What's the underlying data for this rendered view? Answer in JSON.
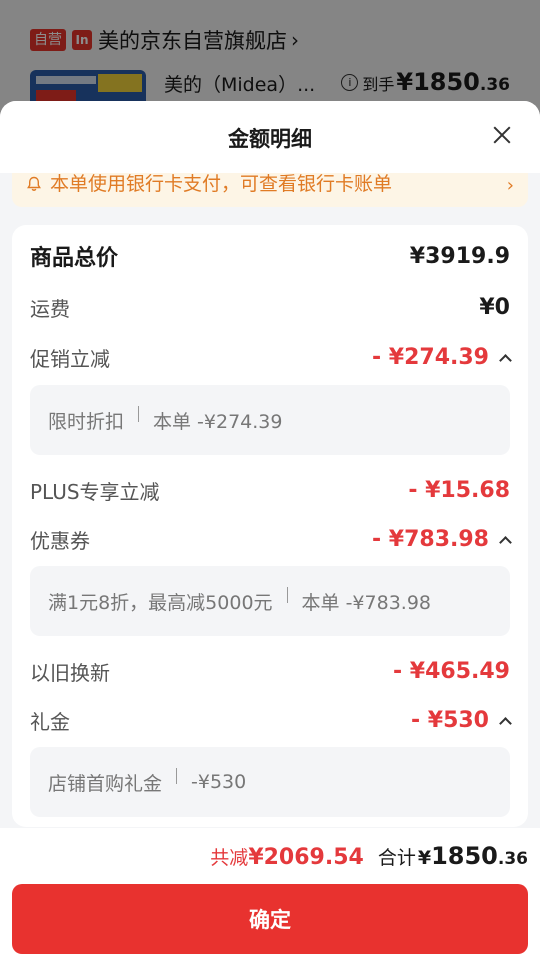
{
  "background": {
    "store": {
      "self_tag": "自营",
      "brand_tag": "In",
      "name": "美的京东自营旗舰店",
      "chevron": "›"
    },
    "product": {
      "title": "美的（Midea）...",
      "price_label": "到手",
      "price_main": "¥1850",
      "price_decimal": ".36"
    }
  },
  "sheet": {
    "title": "金额明细",
    "notice": {
      "text": "本单使用银行卡支付，可查看银行卡账单",
      "chevron": "›"
    },
    "rows": {
      "total": {
        "label": "商品总价",
        "value": "¥3919.9"
      },
      "shipping": {
        "label": "运费",
        "value": "¥0"
      },
      "promo": {
        "label": "促销立减",
        "value": "- ¥274.39"
      },
      "promo_detail": {
        "name": "限时折扣",
        "desc": "本单 -¥274.39"
      },
      "plus": {
        "label": "PLUS专享立减",
        "value": "- ¥15.68"
      },
      "coupon": {
        "label": "优惠券",
        "value": "- ¥783.98"
      },
      "coupon_detail": {
        "name": "满1元8折，最高减5000元",
        "desc": "本单 -¥783.98"
      },
      "tradein": {
        "label": "以旧换新",
        "value": "- ¥465.49"
      },
      "gift": {
        "label": "礼金",
        "value": "- ¥530"
      },
      "gift_detail": {
        "name": "店铺首购礼金",
        "desc": "-¥530"
      }
    }
  },
  "footer": {
    "reduce_label": "共减",
    "reduce_value": "¥2069.54",
    "total_label": "合计",
    "total_currency": "¥",
    "total_main": "1850",
    "total_decimal": ".36",
    "confirm_label": "确定"
  },
  "colors": {
    "accent_red": "#e4393c",
    "notice_orange": "#e07b25",
    "notice_bg": "#fdf5e6"
  }
}
